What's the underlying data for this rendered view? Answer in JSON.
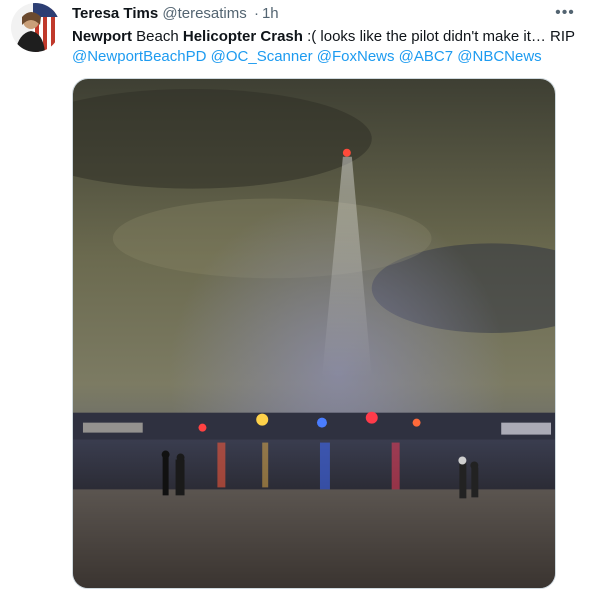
{
  "tweet": {
    "author_name": "Teresa Tims",
    "handle": "@teresatims",
    "separator": "·",
    "time": "1h",
    "more_icon": "more-horizontal-icon",
    "text_parts": {
      "p1": "Newport",
      "p2": " Beach ",
      "p3": "Helicopter Crash",
      "p4": " :( looks like the pilot didn't make it… RIP"
    },
    "mentions": [
      "@NewportBeachPD",
      "@OC_Scanner",
      "@FoxNews",
      "@ABC7",
      "@NBCNews"
    ]
  },
  "colors": {
    "text": "#0f1419",
    "secondary": "#536471",
    "link": "#1d9bf0"
  }
}
